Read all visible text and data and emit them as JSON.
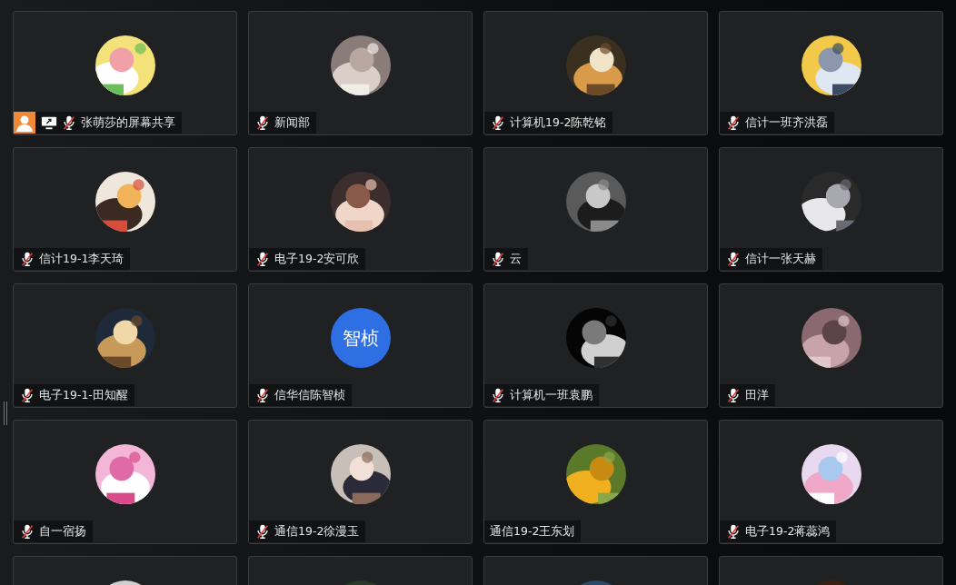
{
  "tiles": [
    {
      "name": "张萌莎的屏幕共享",
      "host": true,
      "sharing": true,
      "muted": true,
      "avatar": {
        "kind": "picture"
      }
    },
    {
      "name": "新闻部",
      "host": false,
      "sharing": false,
      "muted": true,
      "avatar": {
        "kind": "picture"
      }
    },
    {
      "name": "计算机19-2陈乾铭",
      "host": false,
      "sharing": false,
      "muted": true,
      "avatar": {
        "kind": "picture"
      }
    },
    {
      "name": "信计一班齐洪磊",
      "host": false,
      "sharing": false,
      "muted": true,
      "avatar": {
        "kind": "picture"
      }
    },
    {
      "name": "信计19-1李天琦",
      "host": false,
      "sharing": false,
      "muted": true,
      "avatar": {
        "kind": "picture"
      }
    },
    {
      "name": "电子19-2安可欣",
      "host": false,
      "sharing": false,
      "muted": true,
      "avatar": {
        "kind": "picture"
      }
    },
    {
      "name": "云",
      "host": false,
      "sharing": false,
      "muted": true,
      "avatar": {
        "kind": "picture"
      }
    },
    {
      "name": "信计一张天赫",
      "host": false,
      "sharing": false,
      "muted": true,
      "avatar": {
        "kind": "picture"
      }
    },
    {
      "name": "电子19-1-田知醒",
      "host": false,
      "sharing": false,
      "muted": true,
      "avatar": {
        "kind": "picture"
      }
    },
    {
      "name": "信华信陈智桢",
      "host": false,
      "sharing": false,
      "muted": true,
      "avatar": {
        "kind": "text",
        "text": "智桢",
        "color": "#2f6fe4"
      }
    },
    {
      "name": "计算机一班袁鹏",
      "host": false,
      "sharing": false,
      "muted": true,
      "avatar": {
        "kind": "picture"
      }
    },
    {
      "name": "田洋",
      "host": false,
      "sharing": false,
      "muted": true,
      "avatar": {
        "kind": "picture"
      }
    },
    {
      "name": "自一宿扬",
      "host": false,
      "sharing": false,
      "muted": true,
      "avatar": {
        "kind": "picture"
      }
    },
    {
      "name": "通信19-2徐漫玉",
      "host": false,
      "sharing": false,
      "muted": true,
      "avatar": {
        "kind": "picture"
      }
    },
    {
      "name": "通信19-2王东划",
      "host": false,
      "sharing": false,
      "muted": false,
      "avatar": {
        "kind": "picture"
      }
    },
    {
      "name": "电子19-2蒋蕊鸿",
      "host": false,
      "sharing": false,
      "muted": true,
      "avatar": {
        "kind": "picture"
      }
    },
    {
      "avatar": {
        "kind": "picture"
      }
    },
    {
      "avatar": {
        "kind": "picture"
      }
    },
    {
      "avatar": {
        "kind": "picture"
      }
    },
    {
      "avatar": {
        "kind": "picture"
      }
    }
  ]
}
